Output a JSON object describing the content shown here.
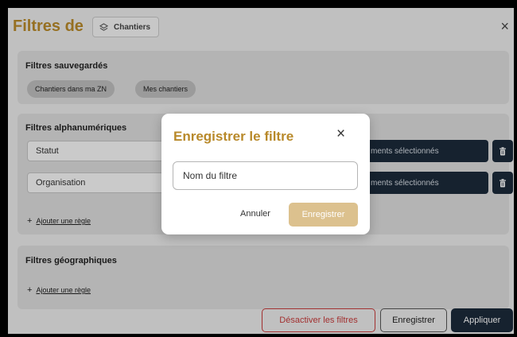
{
  "header": {
    "title": "Filtres de",
    "layer_chip": {
      "icon": "layers-icon",
      "label": "Chantiers"
    },
    "close_icon": "×"
  },
  "saved_filters": {
    "title": "Filtres sauvegardés",
    "items": [
      "Chantiers dans ma ZN",
      "Mes chantiers"
    ]
  },
  "alpha_filters": {
    "title": "Filtres alphanumériques",
    "rules": [
      {
        "field": "Statut",
        "value": "ments sélectionnés"
      },
      {
        "field": "Organisation",
        "value": "ments sélectionnés"
      }
    ],
    "add_rule_plus": "+",
    "add_rule": "Ajouter une règle"
  },
  "geo_filters": {
    "title": "Filtres géographiques",
    "add_rule_plus": "+",
    "add_rule": "Ajouter une règle"
  },
  "footer": {
    "disable_label": "Désactiver les filtres",
    "save_label": "Enregistrer",
    "apply_label": "Appliquer"
  },
  "modal": {
    "title": "Enregistrer le filtre",
    "close_icon": "×",
    "input_placeholder": "Nom du filtre",
    "input_value": "",
    "cancel_label": "Annuler",
    "save_label": "Enregistrer"
  },
  "colors": {
    "accent_gold": "#b8892a",
    "dark_navy": "#1c2a3a",
    "danger_red": "#c63b3b",
    "modal_save_bg": "#dcc18e"
  }
}
